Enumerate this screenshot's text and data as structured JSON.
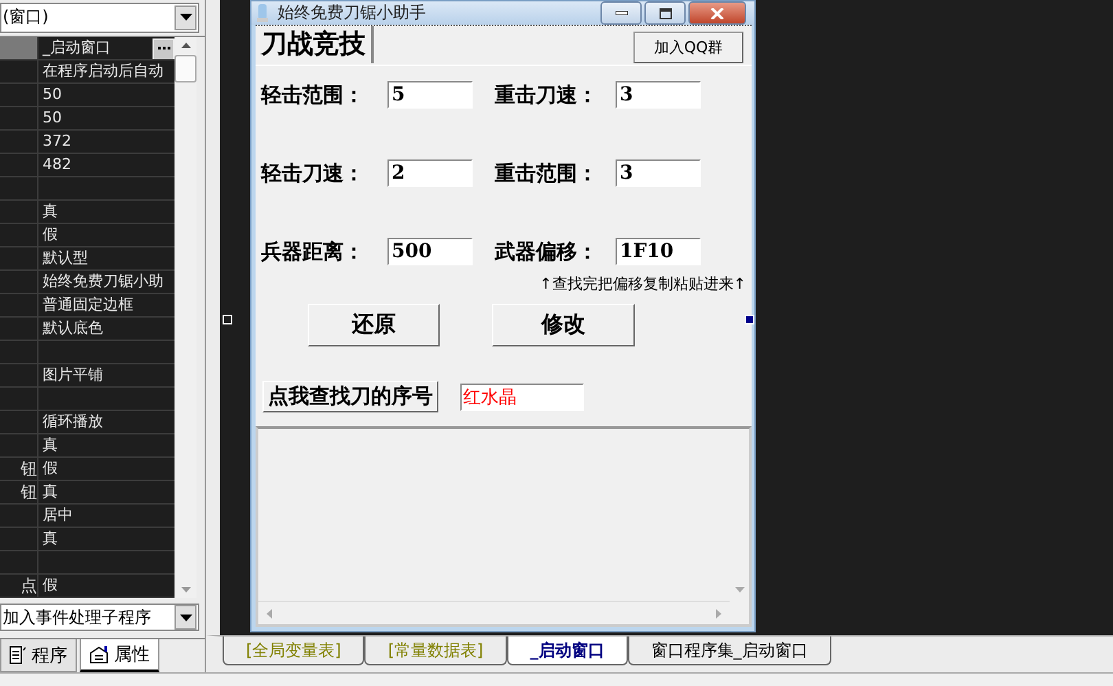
{
  "object_selector": {
    "value": "(窗口)"
  },
  "properties": [
    {
      "value": "_启动窗口",
      "selected": true
    },
    {
      "value": "在程序启动后自动",
      "selected": false
    },
    {
      "value": "50",
      "selected": false
    },
    {
      "value": "50",
      "selected": false
    },
    {
      "value": "372",
      "selected": false
    },
    {
      "value": "482",
      "selected": false
    },
    {
      "selected": false
    },
    {
      "value": "真",
      "selected": false
    },
    {
      "value": "假",
      "selected": false
    },
    {
      "value": "默认型",
      "selected": false
    },
    {
      "value": "始终免费刀锯小助",
      "selected": false
    },
    {
      "value": "普通固定边框",
      "selected": false
    },
    {
      "value": "默认底色",
      "selected": false
    },
    {
      "selected": false
    },
    {
      "value": "图片平铺",
      "selected": false
    },
    {
      "selected": false
    },
    {
      "value": "循环播放",
      "selected": false
    },
    {
      "value": "真",
      "selected": false
    },
    {
      "name": "钮",
      "value": "假",
      "selected": false
    },
    {
      "name": "钮",
      "value": "真",
      "selected": false
    },
    {
      "value": "居中",
      "selected": false
    },
    {
      "value": "真",
      "selected": false
    },
    {
      "selected": false
    },
    {
      "name": "点",
      "value": "假",
      "selected": false
    }
  ],
  "event_selector": {
    "value": "加入事件处理子程序"
  },
  "panel_tabs": [
    {
      "label": "程序",
      "selected": false
    },
    {
      "label": "属性",
      "selected": true
    }
  ],
  "form": {
    "title": "始终免费刀锯小助手",
    "tab": "刀战竞技",
    "qq_button": "加入QQ群",
    "fields": [
      {
        "label": "轻击范围：",
        "value": "5"
      },
      {
        "label": "重击刀速：",
        "value": "3"
      },
      {
        "label": "轻击刀速：",
        "value": "2"
      },
      {
        "label": "重击范围：",
        "value": "3"
      },
      {
        "label": "兵器距离：",
        "value": "500"
      },
      {
        "label": "武器偏移：",
        "value": "1F10"
      }
    ],
    "hint": "↑查找完把偏移复制粘贴进来↑",
    "buttons": [
      "还原",
      "修改"
    ],
    "find_button": "点我查找刀的序号",
    "find_result": "红水晶"
  },
  "editor_tabs": [
    {
      "label": "[全局变量表]",
      "kind": "table",
      "selected": false
    },
    {
      "label": "[常量数据表]",
      "kind": "table",
      "selected": false
    },
    {
      "label": "_启动窗口",
      "kind": "window",
      "selected": true
    },
    {
      "label": "窗口程序集_启动窗口",
      "kind": "code",
      "selected": false
    }
  ]
}
